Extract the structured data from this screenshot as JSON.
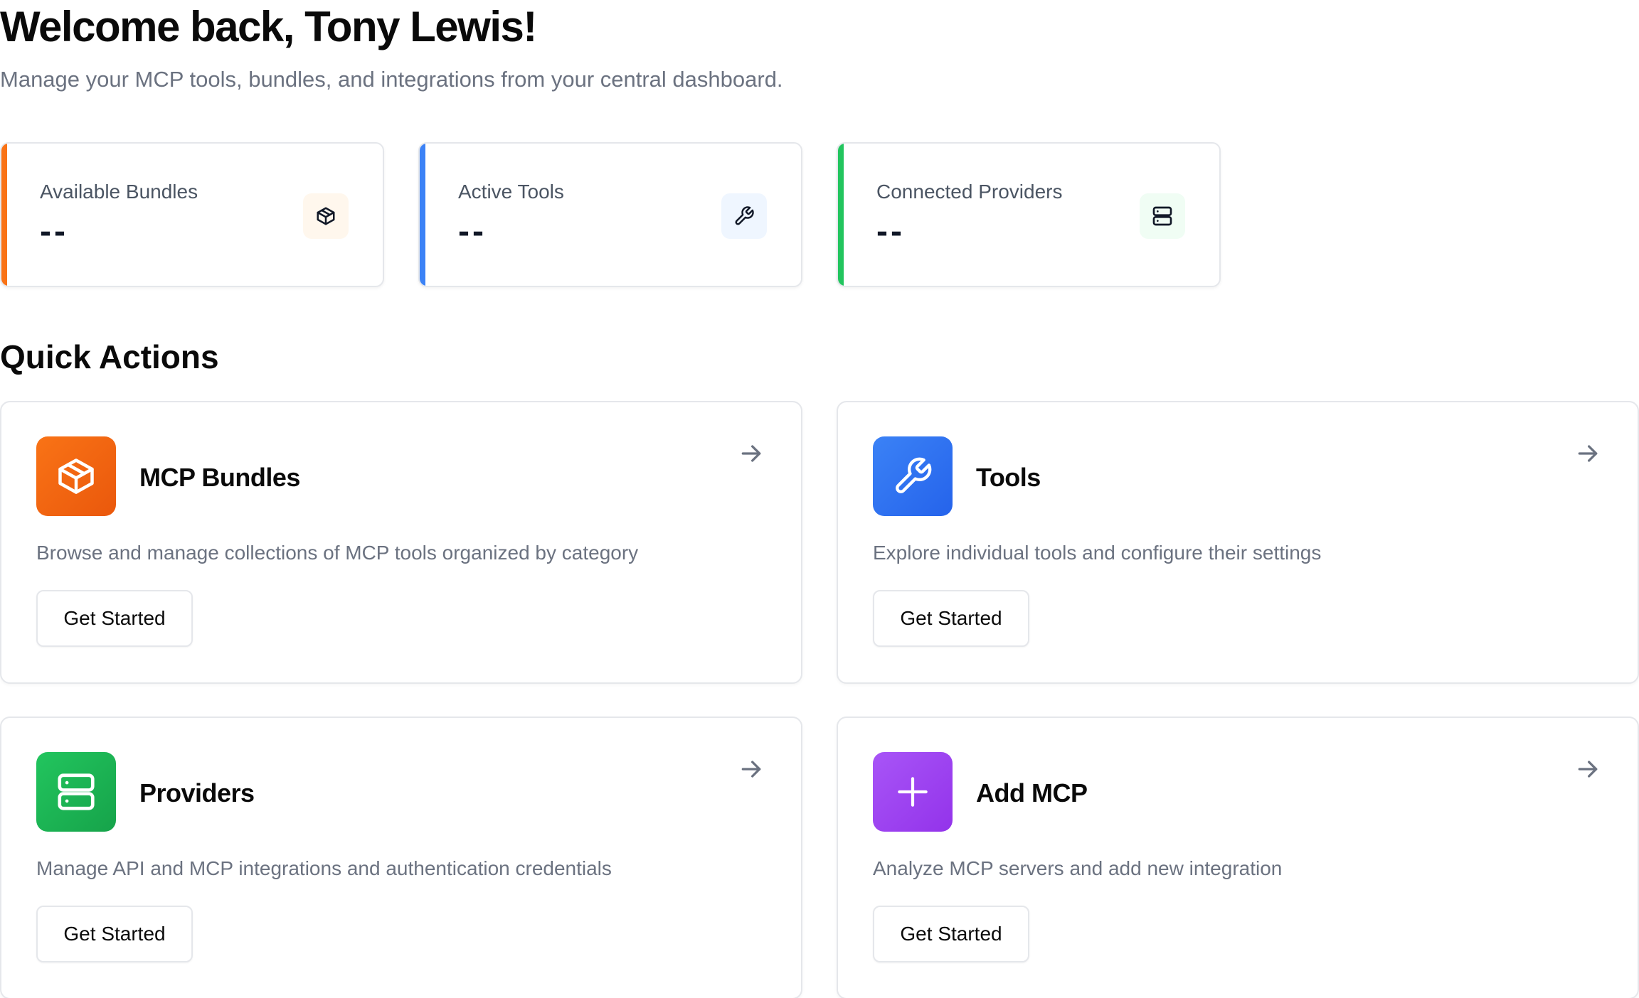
{
  "header": {
    "title": "Welcome back, Tony Lewis!",
    "subtitle": "Manage your MCP tools, bundles, and integrations from your central dashboard."
  },
  "colors": {
    "orange": "#f97316",
    "blue": "#3b82f6",
    "green": "#22c55e",
    "purple": "#a855f7"
  },
  "stats": [
    {
      "label": "Available Bundles",
      "value": "--",
      "icon": "package-icon"
    },
    {
      "label": "Active Tools",
      "value": "--",
      "icon": "wrench-icon"
    },
    {
      "label": "Connected Providers",
      "value": "--",
      "icon": "server-icon"
    }
  ],
  "quick_actions": {
    "title": "Quick Actions",
    "cards": [
      {
        "title": "MCP Bundles",
        "description": "Browse and manage collections of MCP tools organized by category",
        "button": "Get Started",
        "icon": "package-icon"
      },
      {
        "title": "Tools",
        "description": "Explore individual tools and configure their settings",
        "button": "Get Started",
        "icon": "wrench-icon"
      },
      {
        "title": "Providers",
        "description": "Manage API and MCP integrations and authentication credentials",
        "button": "Get Started",
        "icon": "server-icon"
      },
      {
        "title": "Add MCP",
        "description": "Analyze MCP servers and add new integration",
        "button": "Get Started",
        "icon": "plus-icon"
      }
    ]
  }
}
